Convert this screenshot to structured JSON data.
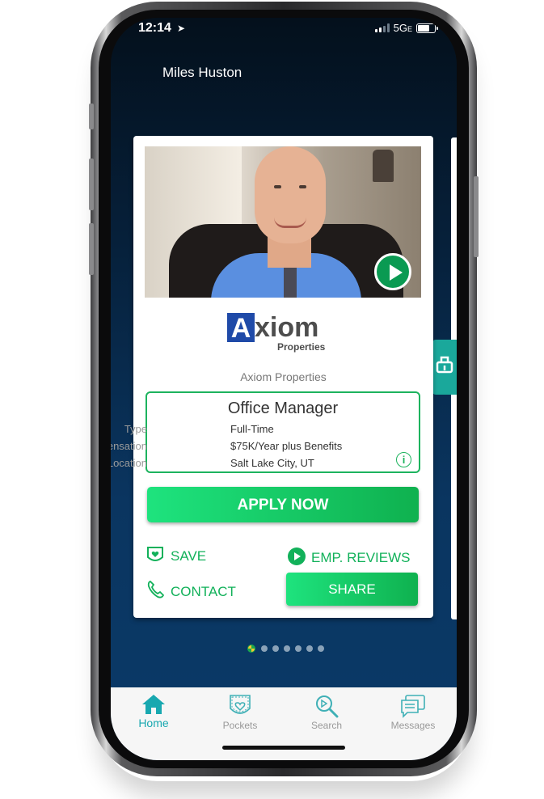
{
  "status_bar": {
    "time": "12:14",
    "network": "5G",
    "network_suffix": "E"
  },
  "header": {
    "user_name": "Miles Huston"
  },
  "card": {
    "company_logo_text": "xiom",
    "company_logo_initial": "A",
    "company_logo_sub": "Properties",
    "company_name": "Axiom Properties",
    "job": {
      "title": "Office Manager",
      "rows": [
        {
          "label": "Type",
          "value": "Full-Time"
        },
        {
          "label": "Compensation",
          "value": "$75K/Year plus Benefits"
        },
        {
          "label": "Location",
          "value": "Salt Lake City, UT"
        }
      ],
      "info_icon": "i"
    },
    "apply_label": "APPLY NOW",
    "save_label": "SAVE",
    "reviews_label": "EMP. REVIEWS",
    "contact_label": "CONTACT",
    "share_label": "SHARE"
  },
  "pager": {
    "total": 7,
    "current": 1
  },
  "tabbar": {
    "items": [
      {
        "label": "Home",
        "icon": "home-icon",
        "active": true
      },
      {
        "label": "Pockets",
        "icon": "pocket-icon",
        "active": false
      },
      {
        "label": "Search",
        "icon": "search-icon",
        "active": false
      },
      {
        "label": "Messages",
        "icon": "messages-icon",
        "active": false
      }
    ]
  },
  "colors": {
    "accent_green": "#12b15a",
    "tab_active": "#18a8b0",
    "brand_blue": "#1f4aa8"
  }
}
